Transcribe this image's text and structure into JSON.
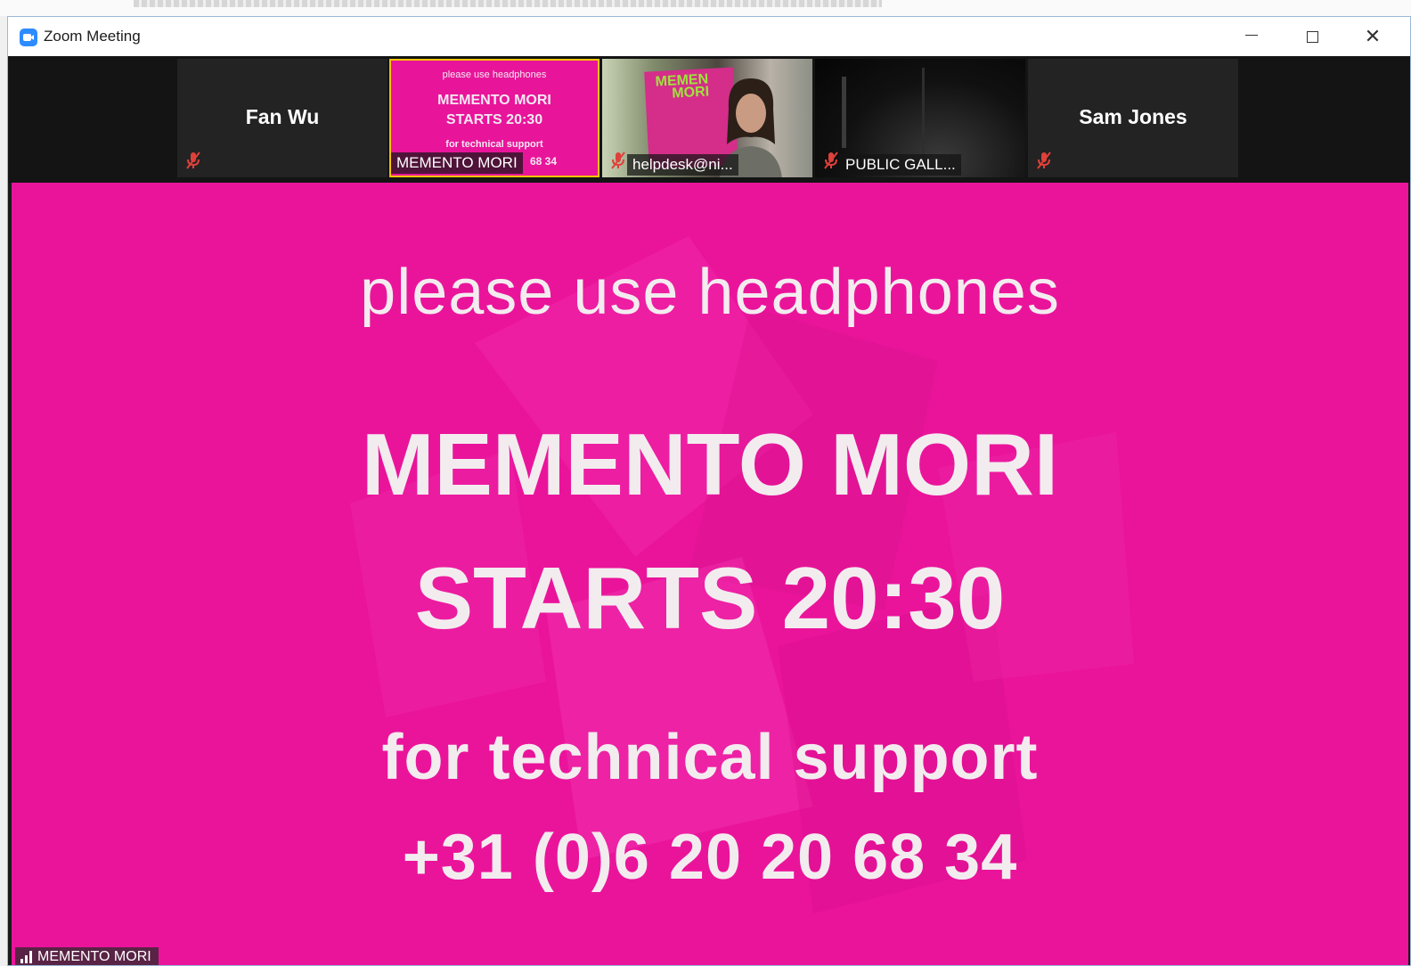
{
  "window": {
    "title": "Zoom Meeting"
  },
  "gallery": {
    "tiles": [
      {
        "name": "Fan Wu",
        "muted": true
      },
      {
        "label": "MEMENTO MORI",
        "active": true,
        "thumb_lines": [
          "please use headphones",
          "MEMENTO MORI",
          "STARTS 20:30",
          "for technical support",
          "68 34"
        ]
      },
      {
        "label": "helpdesk@ni...",
        "muted": true,
        "poster_text": [
          "MEMEN",
          "MORI"
        ]
      },
      {
        "label": "PUBLIC GALL...",
        "muted": true
      },
      {
        "name": "Sam Jones",
        "muted": true
      }
    ]
  },
  "slide": {
    "line1": "please use headphones",
    "line2": "MEMENTO MORI",
    "line3": "STARTS 20:30",
    "line4": "for technical support",
    "line5": "+31 (0)6 20 20 68 34",
    "background_color": "#ea149b"
  },
  "speaker_label": "MEMENTO MORI",
  "colors": {
    "muted_icon": "#e0403a",
    "active_border": "#f5c400",
    "accent": "#2d8cff"
  }
}
